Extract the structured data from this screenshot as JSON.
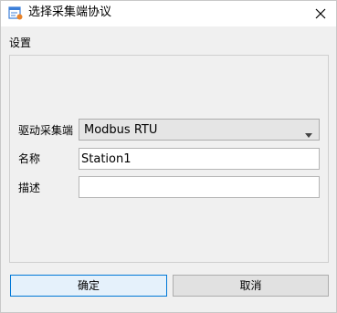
{
  "window": {
    "title": "选择采集端协议",
    "close_icon": "close-icon",
    "app_icon": "form-window-icon"
  },
  "settings": {
    "group_title": "设置",
    "driver_label": "驱动采集端",
    "driver_value": "Modbus RTU",
    "name_label": "名称",
    "name_value": "Station1",
    "description_label": "描述",
    "description_value": ""
  },
  "buttons": {
    "ok_label": "确定",
    "cancel_label": "取消"
  },
  "colors": {
    "accent": "#0078d7",
    "app_icon_blue": "#3c7fd9",
    "app_icon_orange": "#e8832a"
  }
}
